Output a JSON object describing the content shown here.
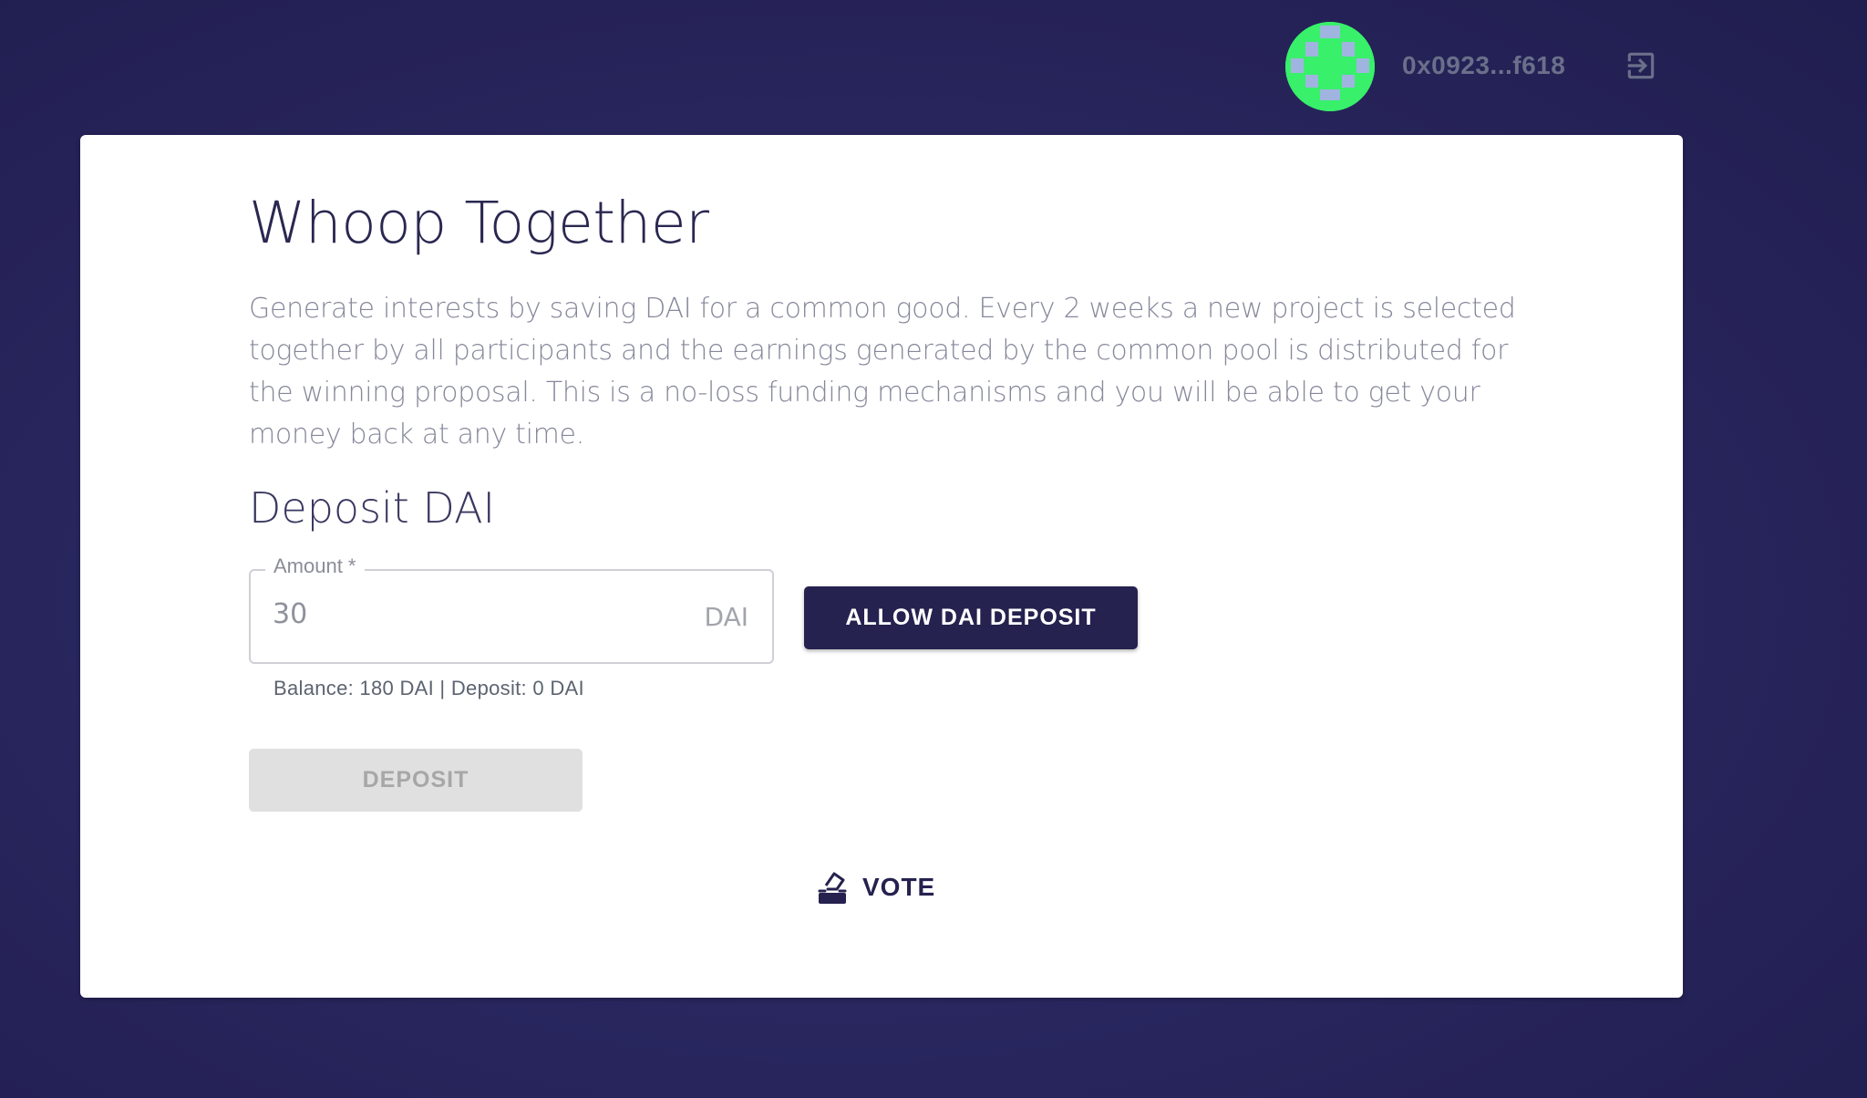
{
  "header": {
    "address": "0x0923...f618",
    "avatar_icon": "identicon-avatar",
    "logout_icon": "logout-icon"
  },
  "card": {
    "title": "Whoop Together",
    "description": "Generate interests by saving DAI for a common good. Every 2 weeks a new project is selected together by all participants and the earnings generated by the common pool is distributed for the winning proposal. This is a no-loss funding mechanisms and you will be able to get your money back at any time.",
    "deposit_section": {
      "title": "Deposit DAI",
      "amount_label": "Amount *",
      "amount_value": "30",
      "amount_unit": "DAI",
      "helper_text": "Balance: 180 DAI | Deposit: 0 DAI",
      "allow_button": "ALLOW DAI DEPOSIT",
      "deposit_button": "DEPOSIT"
    },
    "vote": {
      "label": "VOTE",
      "icon": "ballot-icon"
    }
  },
  "colors": {
    "background": "#2a2760",
    "primary": "#25224f",
    "avatar_green": "#38f06a",
    "avatar_blue": "#9fb5e0"
  }
}
